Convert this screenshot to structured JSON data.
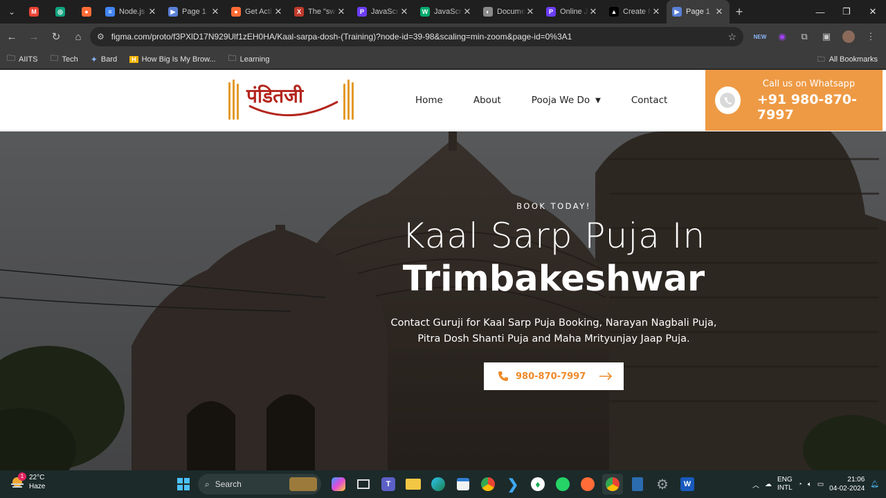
{
  "browser": {
    "tabs": [
      {
        "title": "",
        "pinned": true,
        "icon": "gmail-icon",
        "color": "#ea4335",
        "glyph": "M"
      },
      {
        "title": "",
        "pinned": true,
        "icon": "chatgpt-icon",
        "color": "#10a37f",
        "glyph": "◎"
      },
      {
        "title": "",
        "pinned": true,
        "icon": "postman-icon",
        "color": "#ff6c37",
        "glyph": "●"
      },
      {
        "title": "Node.js",
        "icon": "google-docs-icon",
        "color": "#4285f4",
        "glyph": "≡"
      },
      {
        "title": "Page 1",
        "icon": "figma-play-icon",
        "color": "#5a7fd6",
        "glyph": "▶"
      },
      {
        "title": "Get Acti",
        "icon": "postman-icon",
        "color": "#ff6c37",
        "glyph": "●"
      },
      {
        "title": "The \"sw",
        "icon": "x-icon",
        "color": "#c0392b",
        "glyph": "X"
      },
      {
        "title": "JavaScri",
        "icon": "p-icon",
        "color": "#6c3df5",
        "glyph": "P"
      },
      {
        "title": "JavaScri",
        "icon": "w3schools-icon",
        "color": "#04aa6d",
        "glyph": "W"
      },
      {
        "title": "Docume",
        "icon": "globe-icon",
        "color": "#8a8a8a",
        "glyph": "◐"
      },
      {
        "title": "Online J",
        "icon": "p-icon",
        "color": "#6c3df5",
        "glyph": "P"
      },
      {
        "title": "Create N",
        "icon": "vercel-icon",
        "color": "#000000",
        "glyph": "▲"
      },
      {
        "title": "Page 1",
        "icon": "figma-play-icon",
        "color": "#5a7fd6",
        "glyph": "▶",
        "active": true
      }
    ],
    "url": "figma.com/proto/f3PXlD17N929Ulf1zEH0HA/Kaal-sarpa-dosh-(Training)?node-id=39-98&scaling=min-zoom&page-id=0%3A1",
    "bookmarks": [
      {
        "label": "AIITS",
        "icon": "folder-icon"
      },
      {
        "label": "Tech",
        "icon": "folder-icon"
      },
      {
        "label": "Bard",
        "icon": "bard-icon"
      },
      {
        "label": "How Big Is My Brow...",
        "icon": "h-icon"
      },
      {
        "label": "Learning",
        "icon": "folder-icon"
      }
    ],
    "all_bookmarks": "All Bookmarks"
  },
  "site": {
    "logo_text": "पंडितजी",
    "nav": {
      "home": "Home",
      "about": "About",
      "pooja": "Pooja We Do",
      "contact": "Contact"
    },
    "whatsapp": {
      "label": "Call us on Whatsapp",
      "phone": "+91 980-870-7997"
    },
    "hero": {
      "eyebrow": "BOOK TODAY!",
      "title_line1": "Kaal Sarp Puja In",
      "title_line2": "Trimbakeshwar",
      "subtitle_line1": "Contact Guruji for Kaal Sarp Puja Booking, Narayan Nagbali Puja,",
      "subtitle_line2": "Pitra Dosh Shanti Puja and Maha Mrityunjay Jaap Puja.",
      "cta_phone": "980-870-7997"
    },
    "colors": {
      "accent": "#ee9a45",
      "logo_red": "#b3261e"
    }
  },
  "taskbar": {
    "weather_temp": "22°C",
    "weather_desc": "Haze",
    "weather_badge": "1",
    "search_label": "Search",
    "lang_line1": "ENG",
    "lang_line2": "INTL",
    "time": "21:06",
    "date": "04-02-2024"
  }
}
